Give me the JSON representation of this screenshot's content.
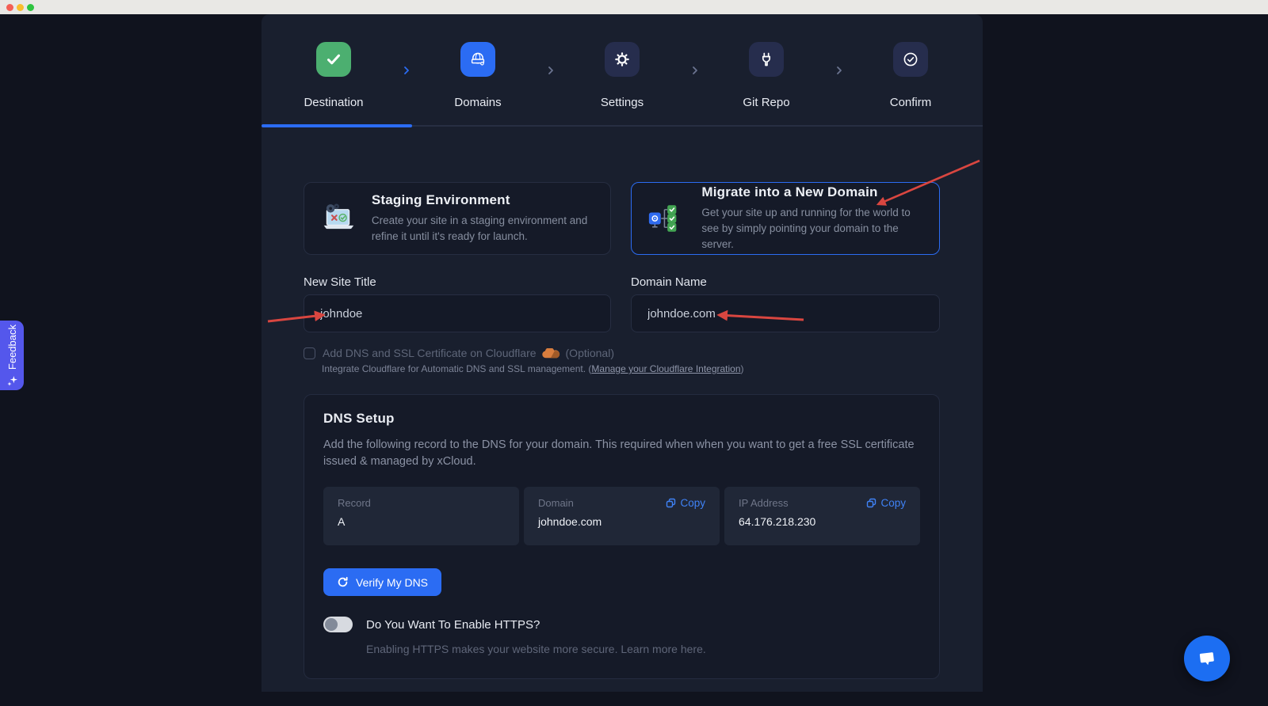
{
  "wizard": {
    "steps": [
      {
        "label": "Destination",
        "status": "completed",
        "icon": "check-icon"
      },
      {
        "label": "Domains",
        "status": "active",
        "icon": "globe-domain-icon"
      },
      {
        "label": "Settings",
        "status": "upcoming",
        "icon": "gear-icon"
      },
      {
        "label": "Git Repo",
        "status": "upcoming",
        "icon": "plug-icon"
      },
      {
        "label": "Confirm",
        "status": "upcoming",
        "icon": "circle-check-icon"
      }
    ]
  },
  "options": {
    "staging": {
      "title": "Staging Environment",
      "description": "Create your site in a staging environment and refine it until it's ready for launch.",
      "icon": "laptop-gears-icon"
    },
    "migrate": {
      "title": "Migrate into a New Domain",
      "description": "Get your site up and running for the world to see by simply pointing your domain to the server.",
      "icon": "site-tree-icon",
      "selected": true
    }
  },
  "form": {
    "site_title": {
      "label": "New Site Title",
      "value": "johndoe"
    },
    "domain": {
      "label": "Domain Name",
      "value": "johndoe.com"
    },
    "cloudflare": {
      "label": "Add DNS and SSL Certificate on Cloudflare",
      "optional": "(Optional)",
      "checked": false,
      "icon": "cloudflare-cloud-icon",
      "help_prefix": "Integrate Cloudflare for Automatic DNS and SSL management. (",
      "link": "Manage your Cloudflare Integration",
      "help_suffix": ")"
    }
  },
  "dns_setup": {
    "title": "DNS Setup",
    "description": "Add the following record to the DNS for your domain. This required when when you want to get a free SSL certificate issued & managed by xCloud.",
    "records": [
      {
        "label": "Record",
        "value": "A"
      },
      {
        "label": "Domain",
        "value": "johndoe.com",
        "copy": "Copy"
      },
      {
        "label": "IP Address",
        "value": "64.176.218.230",
        "copy": "Copy"
      }
    ],
    "verify_button": "Verify My DNS",
    "https_label": "Do You Want To Enable HTTPS?",
    "https_enabled": false,
    "https_help": "Enabling HTTPS makes your website more secure. Learn more here."
  },
  "feedback_tab": {
    "label": "Feedback",
    "icon": "sparkle-icon"
  },
  "chat": {
    "icon": "chat-bubble-icon"
  },
  "colors": {
    "accent_blue": "#2b6cf3",
    "success_green": "#4caf70",
    "idle_navy": "#262d4d",
    "page_background": "#10131e",
    "column_background": "#191f2e",
    "panel_background": "#151a28",
    "cell_background": "#202737",
    "copy_blue": "#3f82f6",
    "feedback_purple": "#5457ec",
    "cloudflare_orange": "#d87d3e",
    "annotation_red": "#d94640"
  }
}
